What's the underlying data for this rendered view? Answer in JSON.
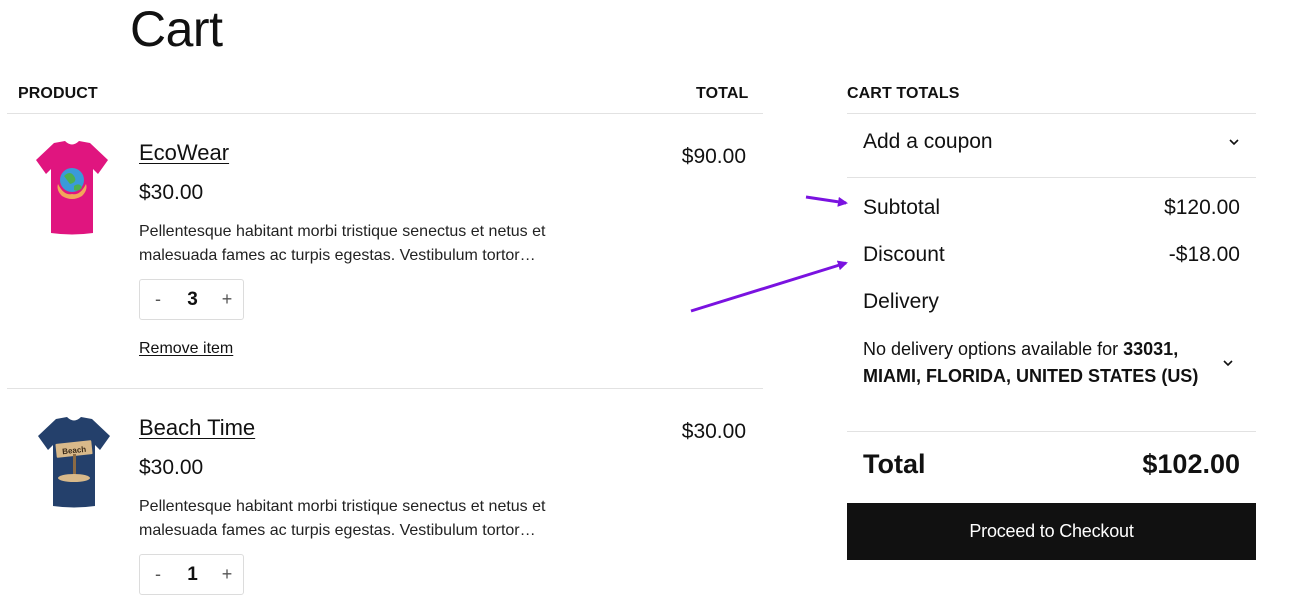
{
  "page": {
    "title": "Cart"
  },
  "table": {
    "col_product": "PRODUCT",
    "col_total": "TOTAL"
  },
  "items": [
    {
      "name": "EcoWear",
      "price": "$30.00",
      "description": "Pellentesque habitant morbi tristique senectus et netus et malesuada fames ac turpis egestas. Vestibulum tortor…",
      "quantity": "3",
      "line_total": "$90.00",
      "remove_label": "Remove item",
      "shirt_color": "#e0157f"
    },
    {
      "name": "Beach Time",
      "price": "$30.00",
      "description": "Pellentesque habitant morbi tristique senectus et netus et malesuada fames ac turpis egestas. Vestibulum tortor…",
      "quantity": "1",
      "line_total": "$30.00",
      "shirt_color": "#24406b"
    }
  ],
  "qty_controls": {
    "minus": "-",
    "plus": "+"
  },
  "totals": {
    "heading": "CART TOTALS",
    "coupon_label": "Add a coupon",
    "subtotal_label": "Subtotal",
    "subtotal_value": "$120.00",
    "discount_label": "Discount",
    "discount_value": "-$18.00",
    "delivery_label": "Delivery",
    "delivery_note_prefix": "No delivery options available for ",
    "delivery_note_location": "33031, MIAMI, FLORIDA, UNITED STATES (US)",
    "total_label": "Total",
    "total_value": "$102.00",
    "checkout_label": "Proceed to Checkout"
  },
  "annotation": {
    "arrow_color": "#7a12e0"
  }
}
